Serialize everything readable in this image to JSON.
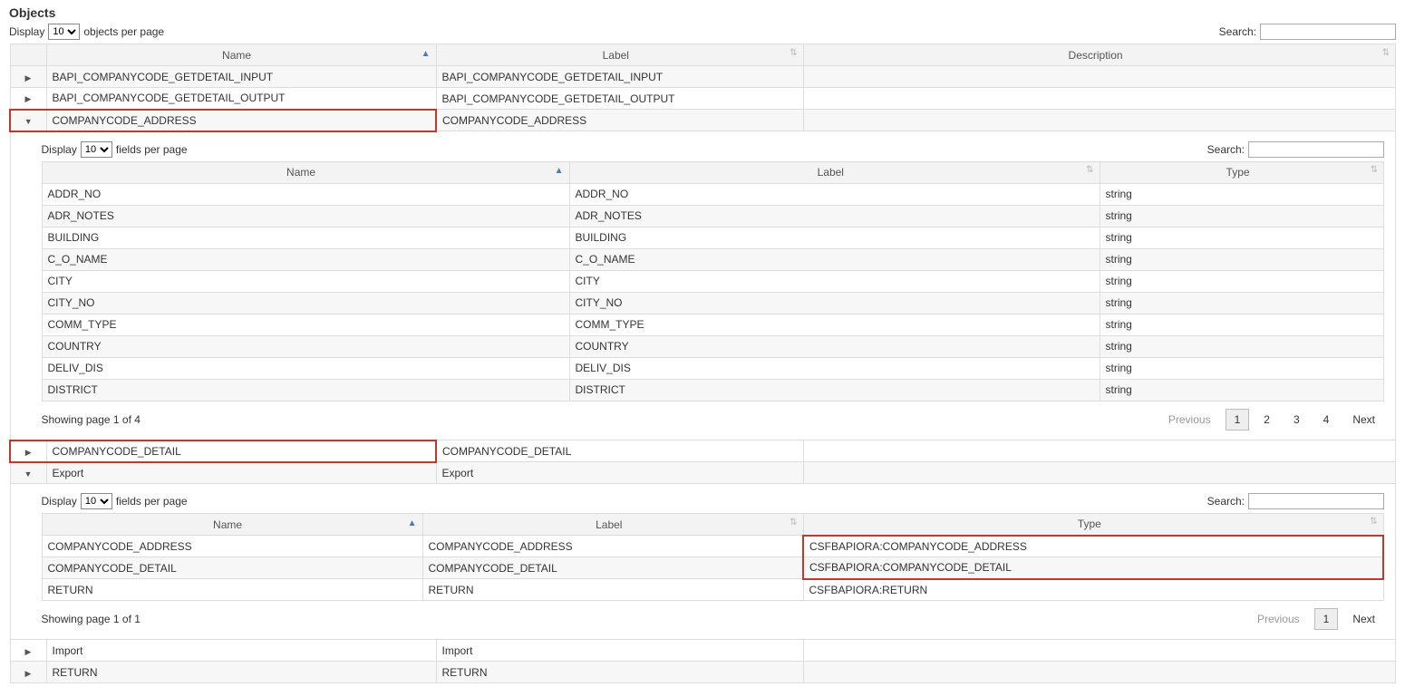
{
  "title": "Objects",
  "outer": {
    "display_prefix": "Display",
    "display_suffix": "objects per page",
    "display_value": "10",
    "search_label": "Search:",
    "columns": {
      "name": "Name",
      "label": "Label",
      "description": "Description"
    }
  },
  "rows": [
    {
      "expanded": false,
      "name": "BAPI_COMPANYCODE_GETDETAIL_INPUT",
      "label": "BAPI_COMPANYCODE_GETDETAIL_INPUT",
      "description": ""
    },
    {
      "expanded": false,
      "name": "BAPI_COMPANYCODE_GETDETAIL_OUTPUT",
      "label": "BAPI_COMPANYCODE_GETDETAIL_OUTPUT",
      "description": ""
    },
    {
      "expanded": true,
      "name": "COMPANYCODE_ADDRESS",
      "label": "COMPANYCODE_ADDRESS",
      "description": "",
      "highlight": true
    },
    {
      "expanded": false,
      "name": "COMPANYCODE_DETAIL",
      "label": "COMPANYCODE_DETAIL",
      "description": "",
      "highlight": true
    },
    {
      "expanded": true,
      "name": "Export",
      "label": "Export",
      "description": ""
    },
    {
      "expanded": false,
      "name": "Import",
      "label": "Import",
      "description": ""
    },
    {
      "expanded": false,
      "name": "RETURN",
      "label": "RETURN",
      "description": ""
    }
  ],
  "address_panel": {
    "display_prefix": "Display",
    "display_suffix": "fields per page",
    "display_value": "10",
    "search_label": "Search:",
    "columns": {
      "name": "Name",
      "label": "Label",
      "type": "Type"
    },
    "rows": [
      {
        "name": "ADDR_NO",
        "label": "ADDR_NO",
        "type": "string"
      },
      {
        "name": "ADR_NOTES",
        "label": "ADR_NOTES",
        "type": "string"
      },
      {
        "name": "BUILDING",
        "label": "BUILDING",
        "type": "string"
      },
      {
        "name": "C_O_NAME",
        "label": "C_O_NAME",
        "type": "string"
      },
      {
        "name": "CITY",
        "label": "CITY",
        "type": "string"
      },
      {
        "name": "CITY_NO",
        "label": "CITY_NO",
        "type": "string"
      },
      {
        "name": "COMM_TYPE",
        "label": "COMM_TYPE",
        "type": "string"
      },
      {
        "name": "COUNTRY",
        "label": "COUNTRY",
        "type": "string"
      },
      {
        "name": "DELIV_DIS",
        "label": "DELIV_DIS",
        "type": "string"
      },
      {
        "name": "DISTRICT",
        "label": "DISTRICT",
        "type": "string"
      }
    ],
    "pager": {
      "info": "Showing page 1 of 4",
      "prev": "Previous",
      "next": "Next",
      "pages": [
        "1",
        "2",
        "3",
        "4"
      ],
      "active": "1"
    }
  },
  "export_panel": {
    "display_prefix": "Display",
    "display_suffix": "fields per page",
    "display_value": "10",
    "search_label": "Search:",
    "columns": {
      "name": "Name",
      "label": "Label",
      "type": "Type"
    },
    "rows": [
      {
        "name": "COMPANYCODE_ADDRESS",
        "label": "COMPANYCODE_ADDRESS",
        "type": "CSFBAPIORA:COMPANYCODE_ADDRESS",
        "hl": "top"
      },
      {
        "name": "COMPANYCODE_DETAIL",
        "label": "COMPANYCODE_DETAIL",
        "type": "CSFBAPIORA:COMPANYCODE_DETAIL",
        "hl": "bot"
      },
      {
        "name": "RETURN",
        "label": "RETURN",
        "type": "CSFBAPIORA:RETURN"
      }
    ],
    "pager": {
      "info": "Showing page 1 of 1",
      "prev": "Previous",
      "next": "Next",
      "pages": [
        "1"
      ],
      "active": "1"
    }
  }
}
